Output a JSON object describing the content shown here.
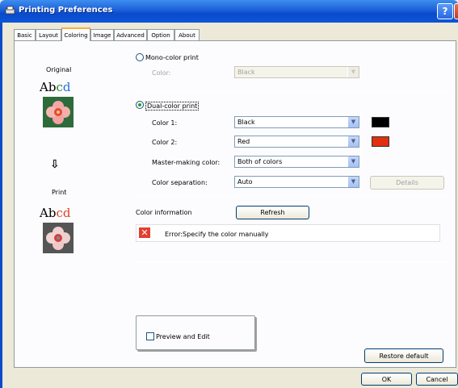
{
  "window": {
    "title": "Printing Preferences",
    "help": "?",
    "close": "X"
  },
  "tabs": [
    "Basic",
    "Layout",
    "Coloring",
    "Image",
    "Advanced",
    "Option",
    "About"
  ],
  "preview": {
    "original_label": "Original",
    "print_label": "Print",
    "sample_text": "Abcd",
    "arrow": "⇩"
  },
  "mono": {
    "label": "Mono-color print",
    "color_label": "Color:",
    "color_value": "Black"
  },
  "dual": {
    "label": "Dual-color print",
    "color1_label": "Color 1:",
    "color1_value": "Black",
    "color2_label": "Color 2:",
    "color2_value": "Red",
    "master_label": "Master-making color:",
    "master_value": "Both of colors",
    "separation_label": "Color separation:",
    "separation_value": "Auto",
    "details": "Details"
  },
  "colorinfo": {
    "label": "Color information",
    "refresh": "Refresh",
    "error": "Error:Specify the color manually"
  },
  "preview_edit": "Preview and Edit",
  "restore": "Restore default",
  "ok": "OK",
  "cancel": "Cancel",
  "colors": {
    "swatch1": "#000000",
    "swatch2": "#e03010"
  }
}
